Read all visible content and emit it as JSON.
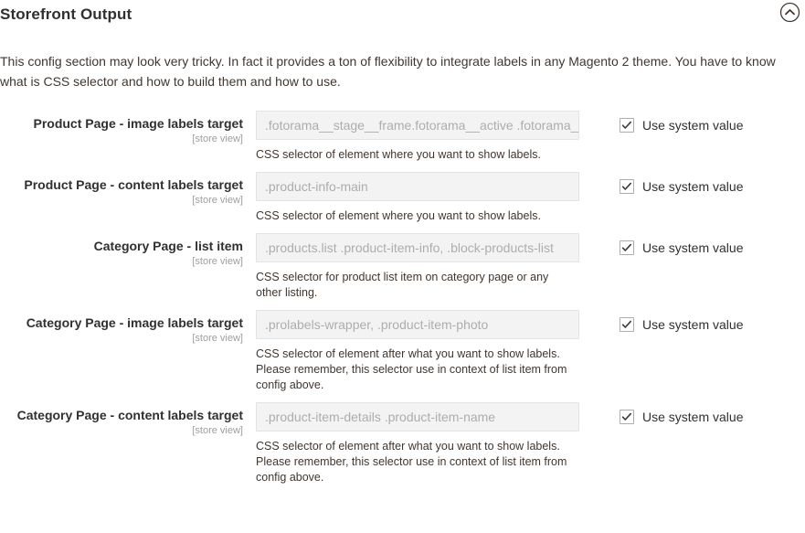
{
  "section": {
    "title": "Storefront Output",
    "collapse_icon": "chevron-up-circle-icon",
    "intro": "This config section may look very tricky. In fact it provides a ton of flexibility to integrate labels in any Magento 2 theme. You have to know what is CSS selector and how to build them and how to use.",
    "scope_label": "[store view]",
    "inherit_label": "Use system value",
    "colors": {
      "text": "#41362f",
      "heading": "#303030",
      "input_bg": "#f3f3f3",
      "input_border": "#e3e3e3",
      "input_text": "#adadad",
      "scope_text": "#9e9e9e",
      "page_bg": "#ffffff"
    }
  },
  "fields": [
    {
      "label": "Product Page - image labels target",
      "scope": "[store view]",
      "value": ".fotorama__stage__frame.fotorama__active .fotorama__img",
      "note": "CSS selector of element where you want to show labels.",
      "inherit_label": "Use system value",
      "inherit_checked": true
    },
    {
      "label": "Product Page - content labels target",
      "scope": "[store view]",
      "value": ".product-info-main",
      "note": "CSS selector of element where you want to show labels.",
      "inherit_label": "Use system value",
      "inherit_checked": true
    },
    {
      "label": "Category Page - list item",
      "scope": "[store view]",
      "value": ".products.list .product-item-info, .block-products-list",
      "note": "CSS selector for product list item on category page or any other listing.",
      "inherit_label": "Use system value",
      "inherit_checked": true
    },
    {
      "label": "Category Page - image labels target",
      "scope": "[store view]",
      "value": ".prolabels-wrapper, .product-item-photo",
      "note": "CSS selector of element after what you want to show labels. Please remember, this selector use in context of list item from config above.",
      "inherit_label": "Use system value",
      "inherit_checked": true
    },
    {
      "label": "Category Page - content labels target",
      "scope": "[store view]",
      "value": ".product-item-details .product-item-name",
      "note": "CSS selector of element after what you want to show labels. Please remember, this selector use in context of list item from config above.",
      "inherit_label": "Use system value",
      "inherit_checked": true
    }
  ]
}
